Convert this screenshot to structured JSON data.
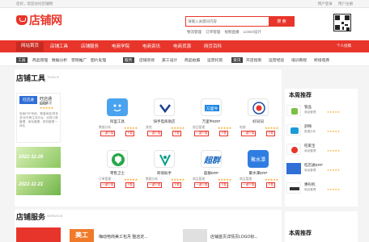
{
  "topbar": {
    "greeting": "您好，欢迎访问店铺网",
    "links": [
      "用户登录",
      "用户注册"
    ]
  },
  "header": {
    "logo_text": "店铺网",
    "search_placeholder": "请输入关键词内容",
    "search_button": "搜 索",
    "hot_links": [
      "物流管理",
      "订单管理",
      "视频直播",
      "LOGO设计"
    ]
  },
  "nav": {
    "items": [
      "网站首页",
      "店铺工具",
      "店铺服务",
      "电商学院",
      "电商资讯",
      "电商货源",
      "网页百科"
    ],
    "active_index": 0,
    "right_label": "个人投稿"
  },
  "subnav": {
    "tag1": "工具",
    "items1": [
      "商品管理",
      "数据分析",
      "营销推广",
      "图片处理"
    ],
    "tag2": "服务",
    "items2": [
      "店铺装修",
      "美工设计",
      "商品拍摄",
      "运营托管"
    ],
    "tag3": "资讯",
    "items3": [
      "开店指南",
      "运营经验",
      "培训教程",
      "跨境电商"
    ]
  },
  "tools": {
    "title": "店铺工具",
    "subtitle": "TOOLS"
  },
  "featured": {
    "logo": "旺店通",
    "title": "旺店通ERP",
    "meta": "商品管理",
    "desc": "电商ERP系统，覆盖淘宝/拼多多/京东等主流平台，实现订单管理、库存管理、财务管理一体化"
  },
  "banners": [
    "2022-11-26",
    "2022-11-21"
  ],
  "cards": [
    {
      "name": "阿里工具",
      "meta": "数据分析",
      "icon": "blue-face-icon"
    },
    {
      "name": "快手电商助店",
      "meta": "其他",
      "icon": "kuaishou-icon"
    },
    {
      "name": "万里牛ERP",
      "meta": "商品管理",
      "icon": "wanliniu-icon"
    },
    {
      "name": "好词词",
      "meta": "电商",
      "icon": "target-icon"
    },
    {
      "name": "零售卫士",
      "meta": "订单管理",
      "icon": "shield-icon"
    },
    {
      "name": "跨境助手",
      "meta": "数据分析",
      "icon": "cross-border-icon"
    },
    {
      "name": "超群ERP",
      "meta": "商品管理",
      "icon": "chaoqun-icon"
    },
    {
      "name": "聚水潭ERP",
      "meta": "商品管理",
      "icon": "jushuitan-icon"
    }
  ],
  "card_buttons": [
    "一键下载",
    "下载"
  ],
  "recommend": {
    "title": "本周推荐",
    "items": [
      {
        "name": "管品",
        "meta": "商品管理"
      },
      {
        "name": "舒畅",
        "meta": "数据分析"
      },
      {
        "name": "旺家宝",
        "meta": "商品管理"
      },
      {
        "name": "旺店通ERP",
        "meta": "商品管理"
      },
      {
        "name": "惠码机",
        "meta": "商品管理"
      }
    ]
  },
  "services": {
    "title": "店铺服务",
    "subtitle": "SERVICE",
    "items": [
      "梅动电商美工包月 整店定...",
      "店铺首页详情页LOGO标..."
    ],
    "banner_text": "美工"
  },
  "recommend2": {
    "title": "本周推荐"
  },
  "colors": {
    "brand": "#e8352b",
    "star": "#f6a623"
  }
}
